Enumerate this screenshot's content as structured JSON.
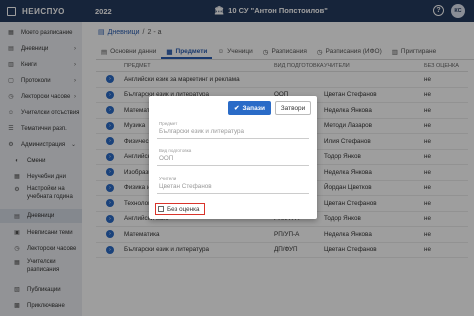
{
  "topbar": {
    "logo": "НЕИСПУО",
    "year": "2022",
    "school": "10 СУ \"Антон Попстоилов\"",
    "help": "?",
    "avatar": "КС"
  },
  "sidebar": {
    "items": [
      {
        "label": "Моето разписание",
        "icon": "calendar-icon",
        "arrow": ""
      },
      {
        "label": "Дневници",
        "icon": "book-icon",
        "arrow": "›"
      },
      {
        "label": "Книги",
        "icon": "books-icon",
        "arrow": "›"
      },
      {
        "label": "Протоколи",
        "icon": "document-icon",
        "arrow": "›"
      },
      {
        "label": "Лекторски часове",
        "icon": "clock-icon",
        "arrow": "›"
      },
      {
        "label": "Учителски отсъствия",
        "icon": "person-icon",
        "arrow": ""
      },
      {
        "label": "Тематични разп.",
        "icon": "list-icon",
        "arrow": ""
      },
      {
        "label": "Администрация",
        "icon": "gear-icon",
        "arrow": "⌄"
      }
    ],
    "subitems": [
      {
        "label": "Смени",
        "icon": "shift-icon"
      },
      {
        "label": "Неучебни дни",
        "icon": "calendar-icon"
      },
      {
        "label": "Настройки на учебната година",
        "icon": "settings-icon"
      },
      {
        "label": "Дневници",
        "icon": "book-icon"
      },
      {
        "label": "Невписани теми",
        "icon": "topic-icon"
      },
      {
        "label": "Лекторски часове",
        "icon": "clock-icon"
      },
      {
        "label": "Учителски разписания",
        "icon": "schedule-icon"
      },
      {
        "label": "Публикации",
        "icon": "publication-icon"
      },
      {
        "label": "Приключване",
        "icon": "lock-icon"
      }
    ]
  },
  "breadcrumb": {
    "root": "Дневници",
    "sep": "/",
    "current": "2 - а"
  },
  "tabs": [
    {
      "label": "Основни данни",
      "icon": "info-icon"
    },
    {
      "label": "Предмети",
      "icon": "subjects-icon"
    },
    {
      "label": "Ученици",
      "icon": "students-icon"
    },
    {
      "label": "Разписания",
      "icon": "calendar-icon"
    },
    {
      "label": "Разписания (ИФО)",
      "icon": "calendar-icon"
    },
    {
      "label": "Пригтиране",
      "icon": "clip-icon"
    }
  ],
  "table": {
    "headers": [
      "ПРЕДМЕТ",
      "ВИД ПОДГОТОВКА",
      "УЧИТЕЛИ",
      "БЕЗ ОЦЕНКА"
    ],
    "rows": [
      [
        "Английски език за маркетинг и реклама",
        "",
        "",
        "не"
      ],
      [
        "Български език и литература",
        "ООП",
        "Цветан Стефанов",
        "не"
      ],
      [
        "Математика",
        "ООП",
        "Неделка Янкова",
        "не"
      ],
      [
        "Музика",
        "ООП",
        "Методи Лазаров",
        "не"
      ],
      [
        "Физическо възпитание и спорт",
        "ООП",
        "Илия Стефанов",
        "не"
      ],
      [
        "Английски език",
        "ООП",
        "Тодор Янков",
        "не"
      ],
      [
        "Изобразително изкуство",
        "ООП",
        "Неделка Янкова",
        "не"
      ],
      [
        "Физика и астрономия",
        "ООП",
        "Йордан Цветков",
        "не"
      ],
      [
        "Технологии и предприемачество",
        "ООП",
        "Цветан Стефанов",
        "не"
      ],
      [
        "Английски език",
        "РП/УП-А",
        "Тодор Янков",
        "не"
      ],
      [
        "Математика",
        "РП/УП-А",
        "Неделка Янкова",
        "не"
      ],
      [
        "Български език и литература",
        "ДП/ФУП",
        "Цветан Стефанов",
        "не"
      ]
    ]
  },
  "modal": {
    "save_label": "Запази",
    "close_label": "Затвори",
    "fields": [
      {
        "label": "Предмет",
        "value": "Български език и литература"
      },
      {
        "label": "Вид подготовка",
        "value": "ООП"
      },
      {
        "label": "Учители",
        "value": "Цветан Стефанов"
      }
    ],
    "checkbox_label": "Без оценка",
    "checked": false
  },
  "colors": {
    "topbar": "#253a5e",
    "accent": "#2a6bc7",
    "highlight": "#d9342b"
  }
}
